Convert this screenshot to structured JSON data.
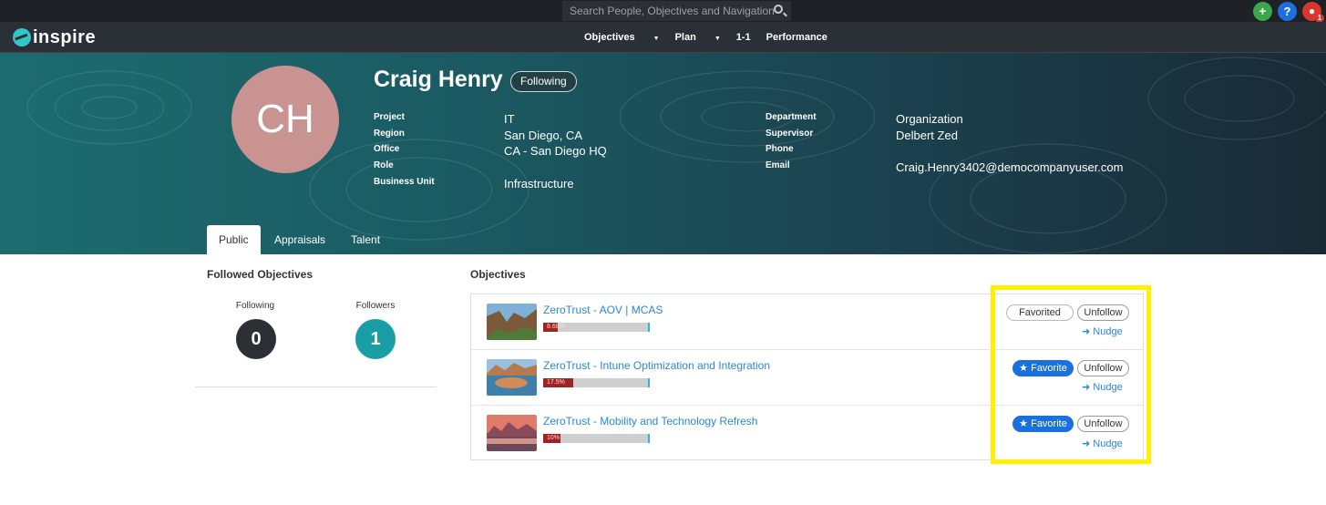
{
  "topbar": {
    "search_placeholder": "Search People, Objectives and Navigation",
    "notification_count": "1"
  },
  "nav": {
    "logo_text": "inspire",
    "links": [
      "Objectives",
      "Plan",
      "1-1",
      "Performance"
    ]
  },
  "profile": {
    "initials": "CH",
    "name": "Craig Henry",
    "follow_status": "Following",
    "fields_left": [
      {
        "label": "Project",
        "value": "IT"
      },
      {
        "label": "Region",
        "value": "San Diego, CA"
      },
      {
        "label": "Office",
        "value": "CA - San Diego HQ"
      },
      {
        "label": "Role",
        "value": ""
      },
      {
        "label": "Business Unit",
        "value": "Infrastructure"
      }
    ],
    "fields_right": [
      {
        "label": "Department",
        "value": "Organization"
      },
      {
        "label": "Supervisor",
        "value": "Delbert Zed"
      },
      {
        "label": "Phone",
        "value": ""
      },
      {
        "label": "Email",
        "value": "Craig.Henry3402@democompanyuser.com"
      }
    ]
  },
  "tabs": [
    "Public",
    "Appraisals",
    "Talent"
  ],
  "followed": {
    "title": "Followed Objectives",
    "following_label": "Following",
    "following_count": "0",
    "followers_label": "Followers",
    "followers_count": "1"
  },
  "objectives": {
    "title": "Objectives",
    "items": [
      {
        "title": "ZeroTrust - AOV | MCAS",
        "progress_text": "8.68%",
        "progress": 0.0868,
        "favorite_label": "Favorited",
        "favorited": true,
        "unfollow_label": "Unfollow",
        "nudge_label": "Nudge"
      },
      {
        "title": "ZeroTrust - Intune Optimization and Integration",
        "progress_text": "17.5%",
        "progress": 0.175,
        "favorite_label": "Favorite",
        "favorited": false,
        "unfollow_label": "Unfollow",
        "nudge_label": "Nudge"
      },
      {
        "title": "ZeroTrust - Mobility and Technology Refresh",
        "progress_text": "10%",
        "progress": 0.1,
        "favorite_label": "Favorite",
        "favorited": false,
        "unfollow_label": "Unfollow",
        "nudge_label": "Nudge"
      }
    ]
  },
  "colors": {
    "accent_blue": "#1b70e0",
    "progress_red": "#9e2424",
    "highlight_yellow": "#ffef00",
    "followers_teal": "#1a9ea6",
    "following_dark": "#2c3035"
  }
}
